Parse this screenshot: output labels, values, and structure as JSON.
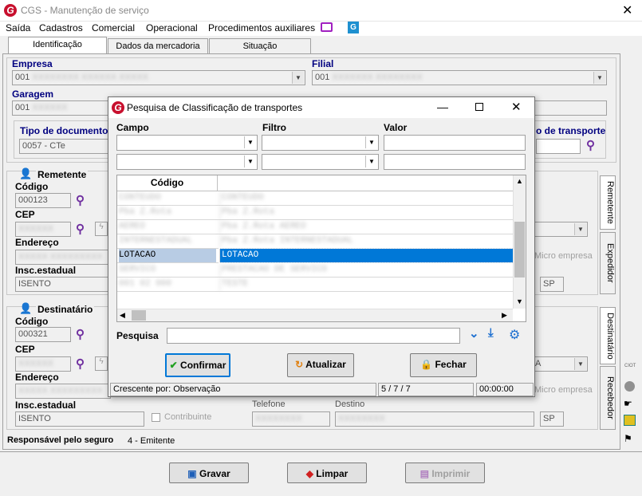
{
  "window": {
    "title": "CGS - Manutenção de serviço"
  },
  "menu": [
    "Saída",
    "Cadastros",
    "Comercial",
    "Operacional",
    "Procedimentos auxiliares"
  ],
  "tabs": [
    "Identificação",
    "Dados da mercadoria",
    "Situação"
  ],
  "main": {
    "empresa_label": "Empresa",
    "empresa_value": "001",
    "filial_label": "Filial",
    "filial_value": "001",
    "garagem_label": "Garagem",
    "garagem_value": "001",
    "tipo_doc_label": "Tipo de documento",
    "tipo_doc_value": "0057 - CTe",
    "tipo_transporte_label": "o de transporte",
    "remetente": {
      "title": "Remetente",
      "codigo_label": "Código",
      "codigo_value": "000123",
      "cep_label": "CEP",
      "endereco_label": "Endereço",
      "insc_label": "Insc.estadual",
      "insc_value": "ISENTO",
      "micro_label": "Micro empresa",
      "uf": "SP"
    },
    "destinatario": {
      "title": "Destinatário",
      "codigo_label": "Código",
      "codigo_value": "000321",
      "cep_label": "CEP",
      "endereco_label": "Endereço",
      "insc_label": "Insc.estadual",
      "insc_value": "ISENTO",
      "contribuinte_label": "Contribuinte",
      "telefone_label": "Telefone",
      "destino_label": "Destino",
      "micro_label": "Micro empresa",
      "uf": "SP",
      "uf_dd": "A"
    },
    "responsavel_label": "Responsável pelo seguro",
    "responsavel_value": "4 - Emitente",
    "vtabs": [
      "Remetente",
      "Expedidor",
      "Destinatário",
      "Recebedor"
    ]
  },
  "buttons": {
    "gravar": "Gravar",
    "limpar": "Limpar",
    "imprimir": "Imprimir"
  },
  "dialog": {
    "title": "Pesquisa de Classificação de transportes",
    "campo_label": "Campo",
    "filtro_label": "Filtro",
    "valor_label": "Valor",
    "col_codigo": "Código",
    "rows": [
      {
        "c1": "CONTEUDO",
        "c2": "CONTEUDO"
      },
      {
        "c1": "Pba Z.Rota",
        "c2": "Pba Z.Rota"
      },
      {
        "c1": "AEREO",
        "c2": "Pba Z.Rota AEREO"
      },
      {
        "c1": "INTERNESTADUAL",
        "c2": "Pba Z.Rota INTERNESTADUAL"
      },
      {
        "c1": "LOTACAO",
        "c2": "LOTACAO"
      },
      {
        "c1": "SERVICO",
        "c2": "PRESTACAO DE SERVICO"
      },
      {
        "c1": "001 02 000",
        "c2": "TESTE"
      }
    ],
    "pesquisa_label": "Pesquisa",
    "confirmar": "Confirmar",
    "atualizar": "Atualizar",
    "fechar": "Fechar",
    "status_order": "Crescente por: Observação",
    "status_count": "5 / 7 / 7",
    "status_time": "00:00:00"
  }
}
